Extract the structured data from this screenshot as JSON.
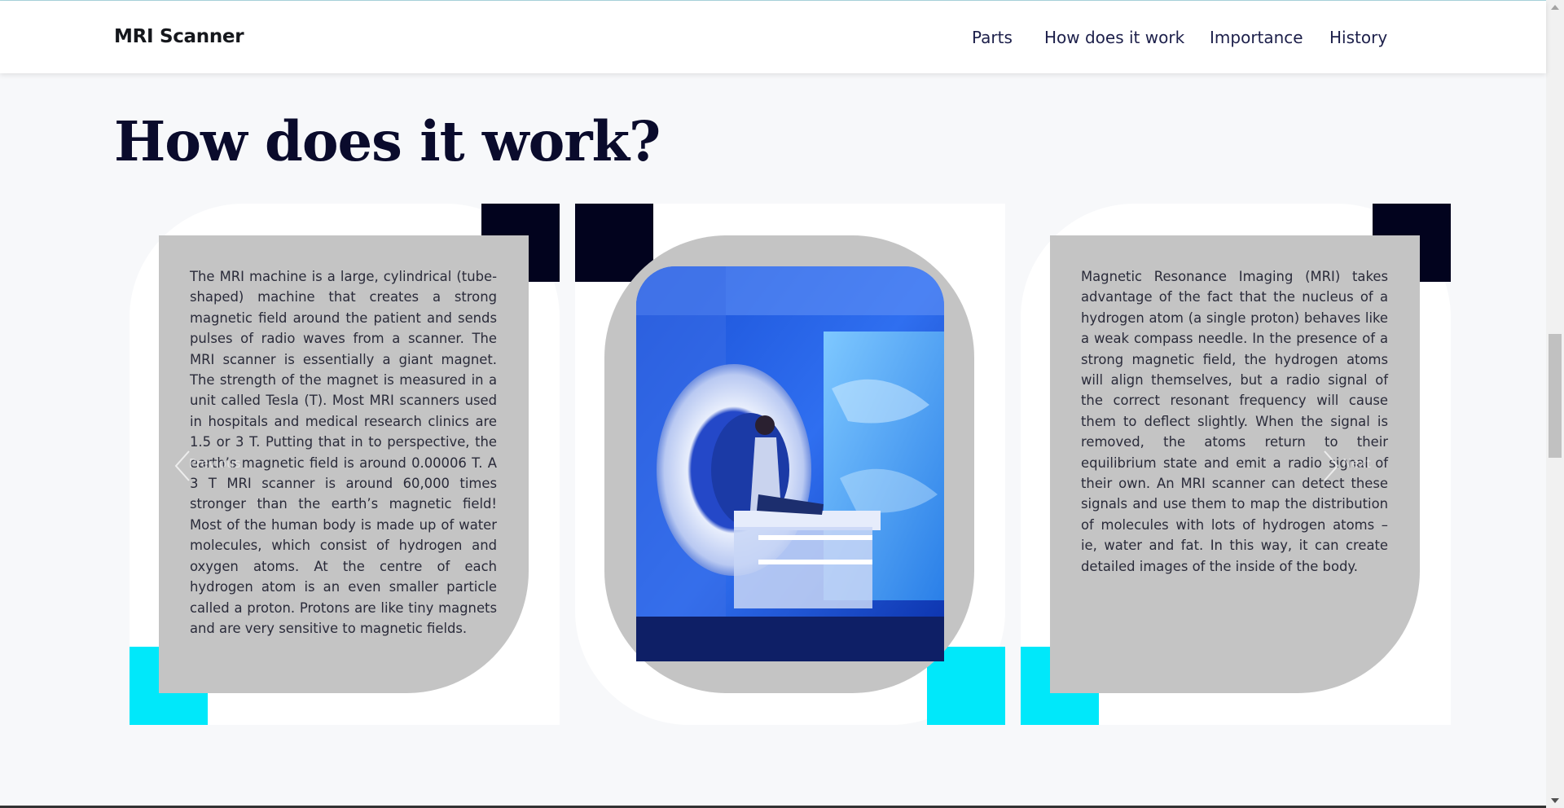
{
  "navbar": {
    "brand": "MRI Scanner",
    "links": [
      "Parts",
      "How does it work",
      "Importance",
      "History"
    ]
  },
  "section": {
    "title": "How does it work?"
  },
  "carousel": {
    "cards": [
      {
        "text": "The MRI machine is a large, cylindrical (tube-shaped) machine that creates a strong magnetic field around the patient and sends pulses of radio waves from a scanner. The MRI scanner is essentially a giant magnet. The strength of the magnet is measured in a unit called Tesla (T). Most MRI scanners used in hospitals and medical research clinics are 1.5 or 3 T. Putting that in to perspective, the earth’s magnetic field is around 0.00006 T. A 3 T MRI scanner is around 60,000 times stronger than the earth’s magnetic field! Most of the human body is made up of water molecules, which consist of hydrogen and oxygen atoms. At the centre of each hydrogen atom is an even smaller particle called a proton. Protons are like tiny magnets and are very sensitive to magnetic fields."
      },
      {
        "image": "mri-scanner-photo"
      },
      {
        "text": "Magnetic Resonance Imaging (MRI) takes advantage of the fact that the nucleus of a hydrogen atom (a single proton) behaves like a weak compass needle. In the presence of a strong magnetic field, the hydrogen atoms will align themselves, but a radio signal of the correct resonant frequency will cause them to deflect slightly. When the signal is removed, the atoms return to their equilibrium state and emit a radio signal of their own. An MRI scanner can detect these signals and use them to map the distribution of molecules with lots of hydrogen atoms – ie, water and fat. In this way, it can create detailed images of the inside of the body."
      }
    ],
    "prev_icon": "chevron-left-icon",
    "next_icon": "chevron-right-icon",
    "prev_label": "Previous",
    "next_label": "Next"
  },
  "colors": {
    "dark_accent": "#02031e",
    "cyan_accent": "#00e8fa",
    "card_grey": "#c4c4c4",
    "page_bg": "#f7f8fa"
  }
}
